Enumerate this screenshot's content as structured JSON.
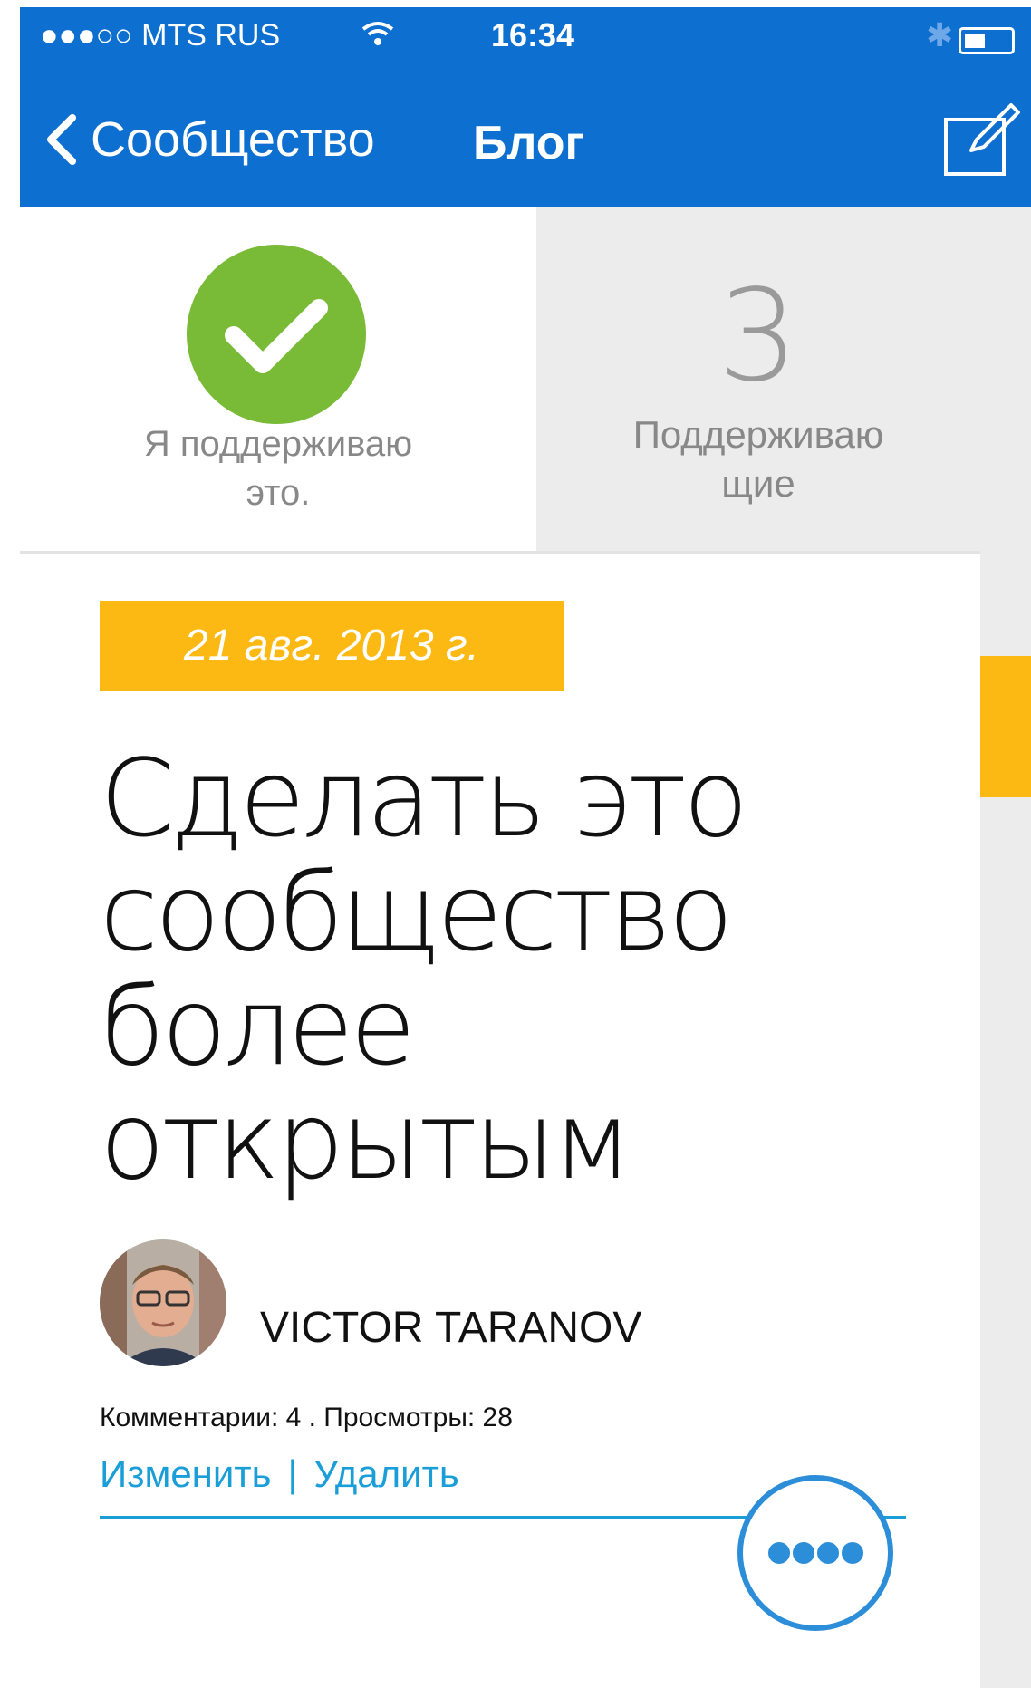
{
  "statusbar": {
    "carrier": "●●●○○ MTS RUS",
    "time": "16:34"
  },
  "navbar": {
    "back_label": "Сообщество",
    "title": "Блог"
  },
  "support": {
    "my_label_line1": "Я поддерживаю",
    "my_label_line2": "это.",
    "count": "3",
    "count_label_line1": "Поддерживаю",
    "count_label_line2": "щие"
  },
  "post": {
    "date": "21 авг. 2013 г.",
    "title_line1": "Сделать это",
    "title_line2": "сообщество",
    "title_line3": "более",
    "title_line4": "открытым",
    "author": "VICTOR TARANOV",
    "meta": "Комментарии: 4  .  Просмотры: 28",
    "edit_label": "Изменить",
    "separator": "|",
    "delete_label": "Удалить"
  },
  "colors": {
    "nav_blue": "#0d6fcf",
    "support_green": "#79bb37",
    "date_yellow": "#fcb913",
    "link_blue": "#1a9ed8"
  },
  "icons": [
    "back-chevron-icon",
    "compose-icon",
    "checkmark-icon",
    "more-dots-icon",
    "wifi-icon",
    "bluetooth-icon",
    "battery-icon"
  ]
}
